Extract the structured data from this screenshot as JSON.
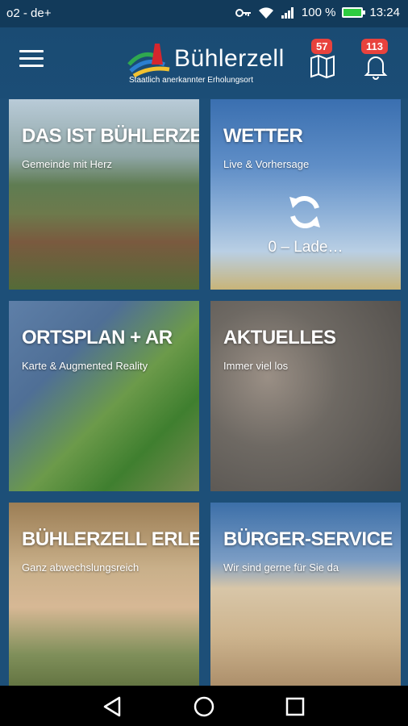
{
  "status_bar": {
    "carrier": "o2 - de+",
    "battery_percent": "100 %",
    "time": "13:24",
    "icons": [
      "key-icon",
      "wifi-icon",
      "signal-icon",
      "battery-icon"
    ]
  },
  "header": {
    "logo_name": "Bühlerzell",
    "logo_subtitle": "Staatlich anerkannter Erholungsort",
    "map_badge": "57",
    "bell_badge": "113"
  },
  "tiles": [
    {
      "title": "DAS IST BÜHLERZELL",
      "subtitle": "Gemeinde mit Herz"
    },
    {
      "title": "WETTER",
      "subtitle": "Live & Vorhersage",
      "status": "0 – Lade…"
    },
    {
      "title": "ORTSPLAN + AR",
      "subtitle": "Karte & Augmented Reality"
    },
    {
      "title": "AKTUELLES",
      "subtitle": "Immer viel los"
    },
    {
      "title": "BÜHLERZELL ERLEBEN",
      "subtitle": "Ganz abwechslungsreich"
    },
    {
      "title": "BÜRGER-SERVICE",
      "subtitle": "Wir sind gerne für Sie da"
    }
  ],
  "colors": {
    "header_bg": "#1b4d76",
    "badge": "#e8423d",
    "statusbar_bg": "#123a5a"
  }
}
